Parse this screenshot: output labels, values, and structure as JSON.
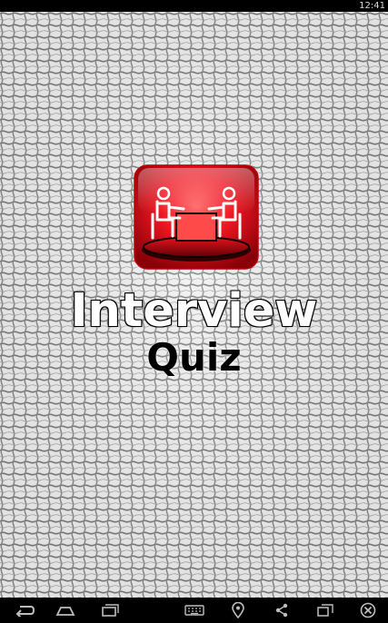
{
  "status_bar": {
    "time": "12:41"
  },
  "app": {
    "title_line1": "Interview",
    "title_line2": "Quiz",
    "icon": "interview-table-icon",
    "accent_color": "#e0101a"
  },
  "nav_bar": {
    "buttons": [
      {
        "name": "back-icon"
      },
      {
        "name": "home-icon"
      },
      {
        "name": "recent-apps-icon"
      },
      {
        "name": "keyboard-icon"
      },
      {
        "name": "location-icon"
      },
      {
        "name": "share-icon"
      },
      {
        "name": "window-icon"
      },
      {
        "name": "close-icon"
      }
    ]
  }
}
